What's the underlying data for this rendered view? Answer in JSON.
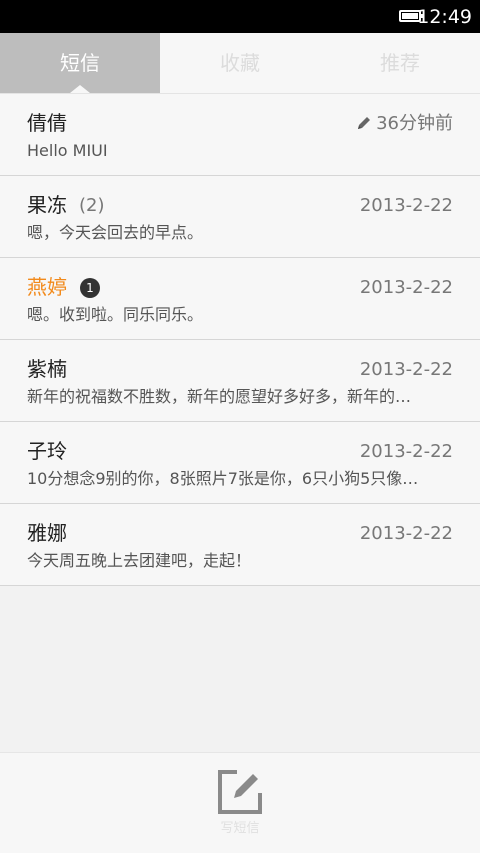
{
  "status_bar": {
    "time": "12:49",
    "battery_icon": "battery-full-icon"
  },
  "tabs": [
    {
      "label": "短信",
      "active": true
    },
    {
      "label": "收藏",
      "active": false
    },
    {
      "label": "推荐",
      "active": false
    }
  ],
  "conversations": [
    {
      "name": "倩倩",
      "count": "",
      "unread": "",
      "date": "36分钟前",
      "draft_icon": "pencil-icon",
      "preview": "Hello MIUI",
      "highlight": false
    },
    {
      "name": "果冻",
      "count": "(2)",
      "unread": "",
      "date": "2013-2-22",
      "preview": "嗯，今天会回去的早点。",
      "highlight": false
    },
    {
      "name": "燕婷",
      "count": "",
      "unread": "1",
      "date": "2013-2-22",
      "preview": "嗯。收到啦。同乐同乐。",
      "highlight": true
    },
    {
      "name": "紫楠",
      "count": "",
      "unread": "",
      "date": "2013-2-22",
      "preview": "新年的祝福数不胜数，新年的愿望好多好多，新年的…",
      "highlight": false
    },
    {
      "name": "子玲",
      "count": "",
      "unread": "",
      "date": "2013-2-22",
      "preview": "10分想念9别的你，8张照片7张是你，6只小狗5只像…",
      "highlight": false
    },
    {
      "name": "雅娜",
      "count": "",
      "unread": "",
      "date": "2013-2-22",
      "preview": "今天周五晚上去团建吧，走起！",
      "highlight": false
    }
  ],
  "bottom_bar": {
    "compose_label": "写短信",
    "compose_icon": "compose-icon"
  },
  "colors": {
    "highlight_name": "#f28a1b",
    "active_tab_bg": "#bdbdbd"
  }
}
